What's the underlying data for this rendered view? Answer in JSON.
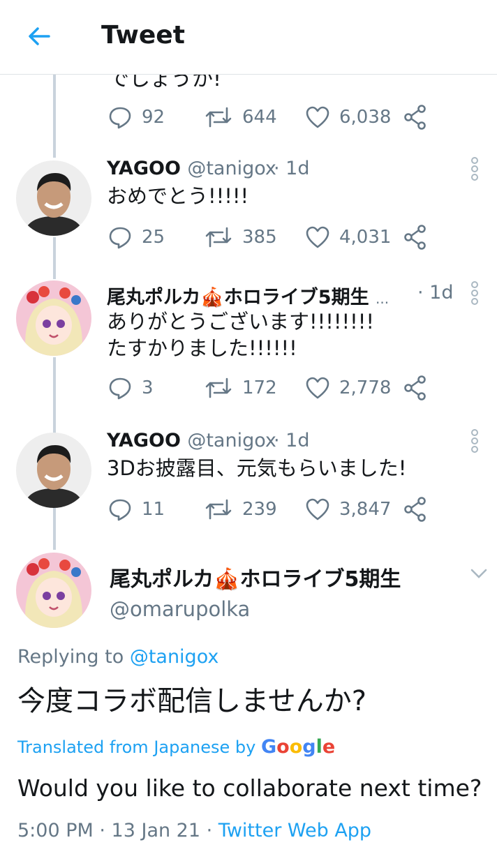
{
  "header": {
    "title": "Tweet"
  },
  "thread": [
    {
      "text_fragment": "でしょうか!",
      "replies": "92",
      "retweets": "644",
      "likes": "6,038"
    },
    {
      "name": "YAGOO",
      "handle": "@tanigox",
      "time": "· 1d",
      "text": [
        "おめでとう!!!!!"
      ],
      "replies": "25",
      "retweets": "385",
      "likes": "4,031"
    },
    {
      "name": "尾丸ポルカ🎪ホロライブ5期生",
      "handle": "...",
      "time": "· 1d",
      "text": [
        "ありがとうございます!!!!!!!!",
        "たすかりました!!!!!!"
      ],
      "replies": "3",
      "retweets": "172",
      "likes": "2,778"
    },
    {
      "name": "YAGOO",
      "handle": "@tanigox",
      "time": "· 1d",
      "text": [
        "3Dお披露目、元気もらいました!"
      ],
      "replies": "11",
      "retweets": "239",
      "likes": "3,847"
    }
  ],
  "main_tweet": {
    "name": "尾丸ポルカ🎪ホロライブ5期生",
    "handle": "@omarupolka",
    "replying_prefix": "Replying to ",
    "replying_to": "@tanigox",
    "text": "今度コラボ配信しませんか?",
    "translated_label": "Translated from Japanese by ",
    "translation_provider": "Google",
    "translation": "Would you like to collaborate next time?",
    "timestamp": "5:00 PM · 13 Jan 21 · ",
    "source_app": "Twitter Web App"
  },
  "colors": {
    "accent": "#1da1f2",
    "secondary_text": "#657786",
    "thread_line": "#c9d3dc"
  }
}
